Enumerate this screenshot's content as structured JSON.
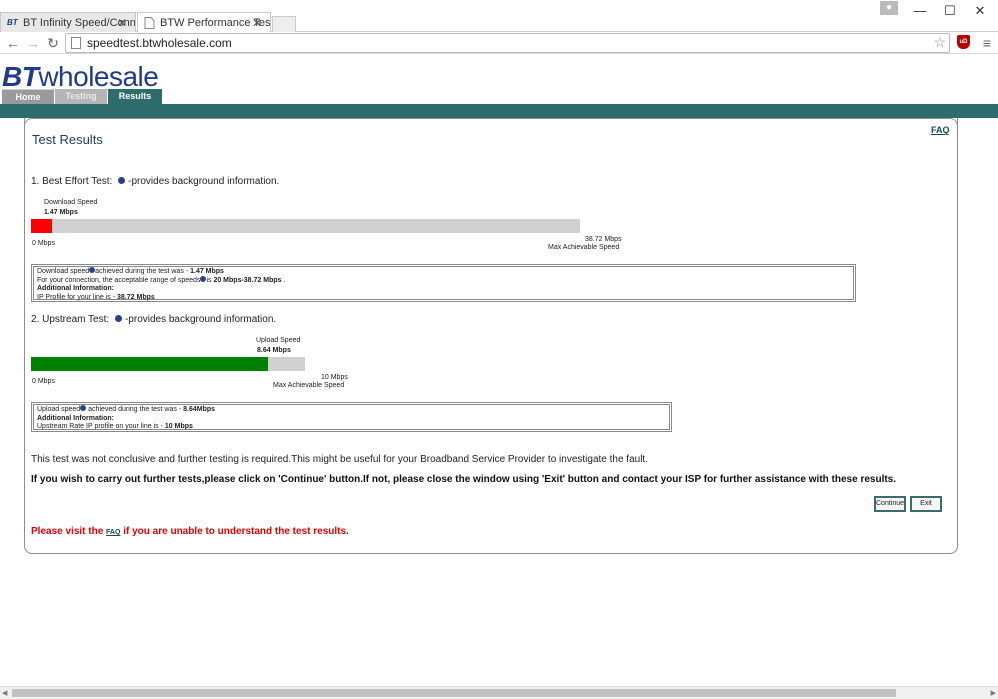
{
  "browser": {
    "tabs": [
      {
        "label": "BT Infinity Speed/Connect",
        "favicon": "BT"
      },
      {
        "label": "BTW Performance Test"
      }
    ],
    "url": "speedtest.btwholesale.com",
    "icons": {
      "back": "←",
      "forward": "→",
      "reload": "↻",
      "star": "☆",
      "menu": "≡",
      "close": "✕",
      "minimize": "—",
      "maximize": "☐",
      "profile": "👤"
    },
    "ublock_label": "uD"
  },
  "site": {
    "logo_bt": "BT",
    "logo_wholesale": "wholesale",
    "nav": {
      "home": "Home",
      "testing": "Testing",
      "results": "Results"
    },
    "brand_color": "#2e6b6b"
  },
  "results": {
    "faq": "FAQ",
    "title": "Test Results",
    "best_effort": {
      "heading_prefix": "1. Best Effort Test:",
      "heading_suffix": "-provides background information.",
      "bar_label": "Download Speed",
      "bar_value": "1.47 Mbps",
      "value": 1.47,
      "max": 38.72,
      "fill_color": "#ff0000",
      "min_label": "0 Mbps",
      "max_label": "38.72 Mbps",
      "max_caption": "Max Achievable Speed",
      "info": {
        "line1_prefix": "Download speed",
        "line1_mid": "achieved during the test was -",
        "line1_value": "1.47 Mbps",
        "line2_prefix": "For your connection, the acceptable range of speeds",
        "line2_mid": "is",
        "line2_value": "20 Mbps-38.72 Mbps",
        "line2_end": ".",
        "line3": "Additional Information:",
        "line4_prefix": "IP Profile for your line is -",
        "line4_value": "38.72 Mbps"
      }
    },
    "upstream": {
      "heading_prefix": "2. Upstream Test:",
      "heading_suffix": "-provides background information.",
      "bar_label": "Upload Speed",
      "bar_value": "8.64 Mbps",
      "value": 8.64,
      "max": 10,
      "fill_color": "#008000",
      "min_label": "0 Mbps",
      "max_label": "10 Mbps",
      "max_caption": "Max Achievable Speed",
      "info": {
        "line1_prefix": "Upload speed",
        "line1_mid": "achieved during the test was -",
        "line1_value": "8.64Mbps",
        "line2": "Additional Information:",
        "line3_prefix": "Upstream Rate IP profile on your line is -",
        "line3_value": "10 Mbps"
      }
    },
    "conclusion": "This test was not conclusive and further testing is required.This might be useful for your Broadband Service Provider to investigate the fault.",
    "instruction": "If you wish to carry out further tests,please click on 'Continue' button.If not, please close the window using 'Exit' button and contact your ISP for further assistance with these results.",
    "continue_label": "Continue",
    "exit_label": "Exit",
    "footer": {
      "prefix": "Please visit the",
      "link": "FAQ",
      "suffix": "if you are unable to understand the test results."
    }
  }
}
